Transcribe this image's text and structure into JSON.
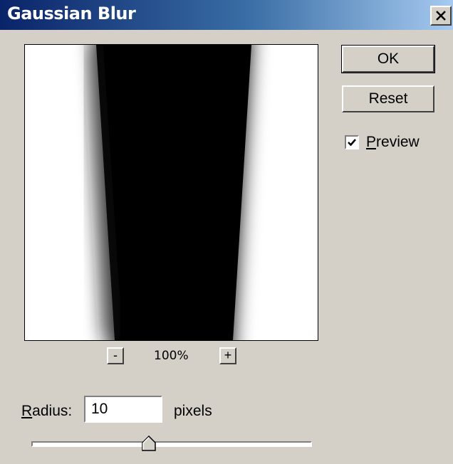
{
  "dialog": {
    "title": "Gaussian Blur",
    "close_symbol": "×"
  },
  "preview_area": {
    "zoom_out_label": "-",
    "zoom_level": "100%",
    "zoom_in_label": "+"
  },
  "buttons": {
    "ok_label": "OK",
    "reset_label": "Reset"
  },
  "preview_option": {
    "label_mnemonic": "P",
    "label_rest": "review",
    "checked": true
  },
  "radius": {
    "label_mnemonic": "R",
    "label_rest": "adius:",
    "value": "10",
    "units": "pixels",
    "slider_fraction": 0.42
  },
  "icons": {
    "close": "close-icon",
    "check": "check-icon",
    "slider_thumb": "slider-thumb-icon"
  }
}
